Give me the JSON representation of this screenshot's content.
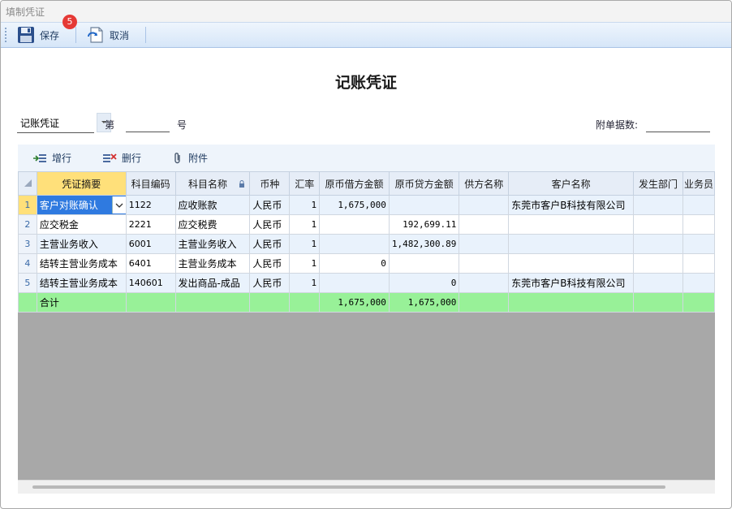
{
  "window": {
    "title": "填制凭证"
  },
  "toolbar": {
    "save_label": "保存",
    "cancel_label": "取消",
    "save_badge": "5"
  },
  "document": {
    "title": "记账凭证",
    "voucher_type": "记账凭证",
    "number_prefix": "第",
    "number_suffix": "号",
    "number_value": "",
    "attachments_label": "附单据数:",
    "attachments_value": ""
  },
  "grid_toolbar": {
    "add_row": "增行",
    "delete_row": "删行",
    "attach": "附件"
  },
  "grid": {
    "columns": [
      "凭证摘要",
      "科目编码",
      "科目名称",
      "币种",
      "汇率",
      "原币借方金额",
      "原币贷方金额",
      "供方名称",
      "客户名称",
      "发生部门",
      "业务员"
    ],
    "rows": [
      [
        "1",
        "客户对账确认",
        "1122",
        "应收账款",
        "人民币",
        "1",
        "1,675,000",
        "",
        "",
        "东莞市客户B科技有限公司",
        "",
        ""
      ],
      [
        "2",
        "应交税金",
        "2221",
        "应交税费",
        "人民币",
        "1",
        "",
        "192,699.11",
        "",
        "",
        "",
        ""
      ],
      [
        "3",
        "主营业务收入",
        "6001",
        "主营业务收入",
        "人民币",
        "1",
        "",
        "1,482,300.89",
        "",
        "",
        "",
        ""
      ],
      [
        "4",
        "结转主营业务成本",
        "6401",
        "主营业务成本",
        "人民币",
        "1",
        "0",
        "",
        "",
        "",
        "",
        ""
      ],
      [
        "5",
        "结转主营业务成本",
        "140601",
        "发出商品-成品",
        "人民币",
        "1",
        "",
        "0",
        "",
        "东莞市客户B科技有限公司",
        "",
        ""
      ]
    ],
    "total": {
      "label": "合计",
      "debit": "1,675,000",
      "credit": "1,675,000"
    }
  },
  "colors": {
    "accent": "#2f7ae0",
    "total_row": "#98f198",
    "header_highlight": "#ffe07a",
    "badge": "#e53935"
  }
}
